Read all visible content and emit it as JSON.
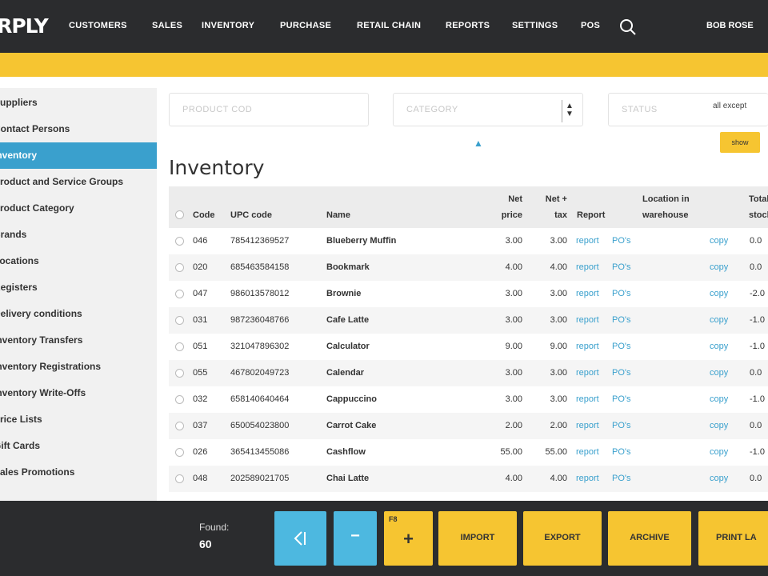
{
  "app": {
    "logo": "ERPLY"
  },
  "nav": {
    "items": [
      "CUSTOMERS",
      "SALES",
      "INVENTORY",
      "PURCHASE",
      "RETAIL CHAIN",
      "REPORTS",
      "SETTINGS",
      "POS"
    ],
    "user": "BOB ROSE"
  },
  "sidebar": {
    "items": [
      "Suppliers",
      "Contact Persons",
      "Inventory",
      "Product and Service Groups",
      "Product Category",
      "Brands",
      "Locations",
      "Registers",
      "Delivery conditions",
      "Inventory Transfers",
      "Inventory Registrations",
      "Inventory Write-Offs",
      "Price Lists",
      "Gift Cards",
      "Sales Promotions"
    ],
    "active_index": 2
  },
  "filters": {
    "product_code_placeholder": "PRODUCT COD",
    "category_placeholder": "CATEGORY",
    "status_placeholder": "STATUS",
    "status_value": "all except"
  },
  "page": {
    "title": "Inventory",
    "small_button": "show"
  },
  "table": {
    "headers": {
      "code": "Code",
      "upc": "UPC code",
      "name": "Name",
      "net_price_1": "Net",
      "net_price_2": "price",
      "net_tax_1": "Net +",
      "net_tax_2": "tax",
      "report": "Report",
      "location_1": "Location in",
      "location_2": "warehouse",
      "total_1": "Total",
      "total_2": "stock"
    },
    "rows": [
      {
        "code": "046",
        "upc": "785412369527",
        "name": "Blueberry Muffin",
        "net": "3.00",
        "tax": "3.00",
        "report": "report",
        "pos": "PO's",
        "copy": "copy",
        "stock": "0.0"
      },
      {
        "code": "020",
        "upc": "685463584158",
        "name": "Bookmark",
        "net": "4.00",
        "tax": "4.00",
        "report": "report",
        "pos": "PO's",
        "copy": "copy",
        "stock": "0.0"
      },
      {
        "code": "047",
        "upc": "986013578012",
        "name": "Brownie",
        "net": "3.00",
        "tax": "3.00",
        "report": "report",
        "pos": "PO's",
        "copy": "copy",
        "stock": "-2.0"
      },
      {
        "code": "031",
        "upc": "987236048766",
        "name": "Cafe Latte",
        "net": "3.00",
        "tax": "3.00",
        "report": "report",
        "pos": "PO's",
        "copy": "copy",
        "stock": "-1.0"
      },
      {
        "code": "051",
        "upc": "321047896302",
        "name": "Calculator",
        "net": "9.00",
        "tax": "9.00",
        "report": "report",
        "pos": "PO's",
        "copy": "copy",
        "stock": "-1.0"
      },
      {
        "code": "055",
        "upc": "467802049723",
        "name": "Calendar",
        "net": "3.00",
        "tax": "3.00",
        "report": "report",
        "pos": "PO's",
        "copy": "copy",
        "stock": "0.0"
      },
      {
        "code": "032",
        "upc": "658140640464",
        "name": "Cappuccino",
        "net": "3.00",
        "tax": "3.00",
        "report": "report",
        "pos": "PO's",
        "copy": "copy",
        "stock": "-1.0"
      },
      {
        "code": "037",
        "upc": "650054023800",
        "name": "Carrot Cake",
        "net": "2.00",
        "tax": "2.00",
        "report": "report",
        "pos": "PO's",
        "copy": "copy",
        "stock": "0.0"
      },
      {
        "code": "026",
        "upc": "365413455086",
        "name": "Cashflow",
        "net": "55.00",
        "tax": "55.00",
        "report": "report",
        "pos": "PO's",
        "copy": "copy",
        "stock": "-1.0"
      },
      {
        "code": "048",
        "upc": "202589021705",
        "name": "Chai Latte",
        "net": "4.00",
        "tax": "4.00",
        "report": "report",
        "pos": "PO's",
        "copy": "copy",
        "stock": "0.0"
      }
    ]
  },
  "footer": {
    "found_label": "Found:",
    "found_count": "60",
    "buttons": {
      "minus": "−",
      "add_key": "F8",
      "add": "+",
      "import": "IMPORT",
      "export": "EXPORT",
      "archive": "ARCHIVE",
      "print": "PRINT LA"
    }
  },
  "colors": {
    "accent_blue": "#3aa0cd",
    "accent_yellow": "#f6c531",
    "dark": "#2b2c2e"
  }
}
